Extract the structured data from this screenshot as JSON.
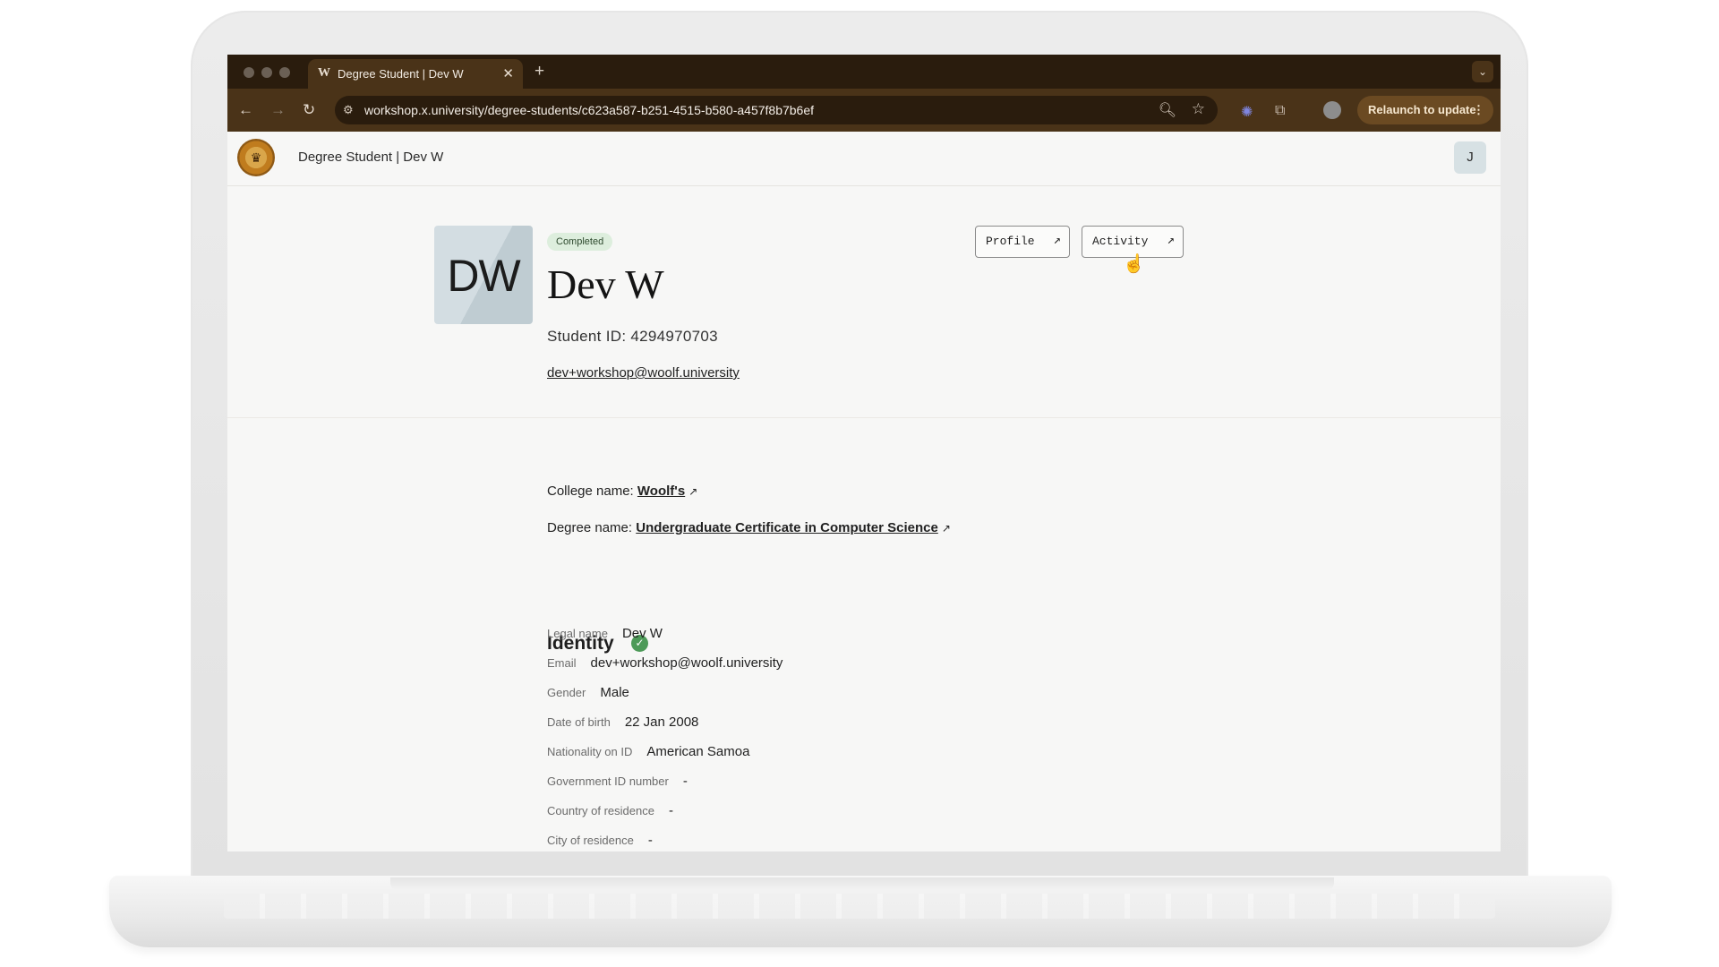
{
  "browser": {
    "tab_title": "Degree Student | Dev W",
    "tab_favicon": "W",
    "url": "workshop.x.university/degree-students/c623a587-b251-4515-b580-a457f8b7b6ef",
    "relaunch_label": "Relaunch to update"
  },
  "app": {
    "title": "Degree Student | Dev W",
    "user_initial": "J"
  },
  "profile": {
    "initials": "DW",
    "status": "Completed",
    "name": "Dev W",
    "student_id": "Student ID: 4294970703",
    "email": "dev+workshop@woolf.university",
    "buttons": {
      "profile": "Profile",
      "activity": "Activity"
    }
  },
  "details": {
    "college_label": "College name:",
    "college_value": "Woolf's",
    "degree_label": "Degree name:",
    "degree_value": "Undergraduate Certificate in Computer Science"
  },
  "identity": {
    "heading": "Identity",
    "fields": [
      {
        "label": "Legal name",
        "value": "Dev W"
      },
      {
        "label": "Email",
        "value": "dev+workshop@woolf.university"
      },
      {
        "label": "Gender",
        "value": "Male"
      },
      {
        "label": "Date of birth",
        "value": "22 Jan 2008"
      },
      {
        "label": "Nationality on ID",
        "value": "American Samoa"
      },
      {
        "label": "Government ID number",
        "value": "-"
      },
      {
        "label": "Country of residence",
        "value": "-"
      },
      {
        "label": "City of residence",
        "value": "-"
      }
    ]
  },
  "colors": {
    "browser_frame": "#2a1c0d",
    "toolbar": "#4a3318",
    "status_badge_bg": "#ddeedd",
    "verified": "#4d9a58"
  },
  "icons": [
    "close-icon",
    "plus-icon",
    "back-arrow-icon",
    "forward-arrow-icon",
    "reload-icon",
    "site-settings-icon",
    "zoom-icon",
    "star-icon",
    "extension-icon",
    "puzzle-icon",
    "profile-avatar-icon",
    "kebab-menu-icon",
    "external-link-icon",
    "check-circle-icon",
    "pointer-cursor-icon"
  ]
}
